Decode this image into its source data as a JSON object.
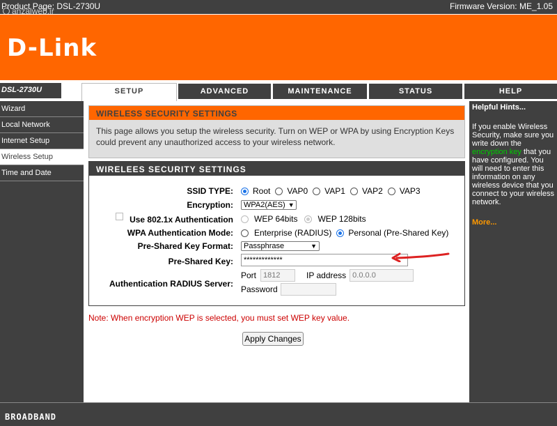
{
  "topbar": {
    "product": "Product Page: DSL-2730U",
    "firmware": "Firmware Version: ME_1.05",
    "watermark": "anzalweb.ir"
  },
  "brand": {
    "logo": "D-Link"
  },
  "tabs": {
    "model": "DSL-2730U",
    "items": [
      "SETUP",
      "ADVANCED",
      "MAINTENANCE",
      "STATUS",
      "HELP"
    ]
  },
  "nav": {
    "items": [
      "Wizard",
      "Local Network",
      "Internet Setup",
      "Wireless Setup",
      "Time and Date"
    ]
  },
  "security_intro": {
    "title": "WIRELESS SECURITY SETTINGS",
    "text": "This page allows you setup the wireless security. Turn on WEP or WPA by using Encryption Keys could prevent any unauthorized access to your wireless network."
  },
  "security_form": {
    "title": "WIRELEES SECURITY SETTINGS",
    "ssid_label": "SSID TYPE:",
    "ssid_options": [
      "Root",
      "VAP0",
      "VAP1",
      "VAP2",
      "VAP3"
    ],
    "encryption_label": "Encryption:",
    "encryption_value": "WPA2(AES)",
    "use8021x_label": "Use 802.1x Authentication",
    "wep64_label": "WEP 64bits",
    "wep128_label": "WEP 128bits",
    "wpa_mode_label": "WPA Authentication Mode:",
    "wpa_enterprise": "Enterprise (RADIUS)",
    "wpa_personal": "Personal (Pre-Shared Key)",
    "psk_format_label": "Pre-Shared Key Format:",
    "psk_format_value": "Passphrase",
    "psk_label": "Pre-Shared Key:",
    "psk_value": "*************",
    "radius_label": "Authentication RADIUS Server:",
    "port_label": "Port",
    "port_value": "1812",
    "ip_label": "IP address",
    "ip_value": "0.0.0.0",
    "password_label": "Password",
    "password_value": ""
  },
  "note": "Note: When encryption WEP is selected, you must set WEP key value.",
  "apply_label": "Apply Changes",
  "hints": {
    "title": "Helpful Hints...",
    "text_before": "If you enable Wireless Security, make sure you write down the",
    "text_green": "encryption key",
    "text_after": "that you have configured. You will need to enter this information on any wireless device that you connect to your wireless network.",
    "more": "More..."
  },
  "footer": {
    "label": "BROADBAND"
  },
  "colors": {
    "accent": "#ff6600",
    "dark": "#404040",
    "radio_on": "#1a73e8",
    "note": "#cc0000",
    "hint_link": "#ff9900"
  }
}
